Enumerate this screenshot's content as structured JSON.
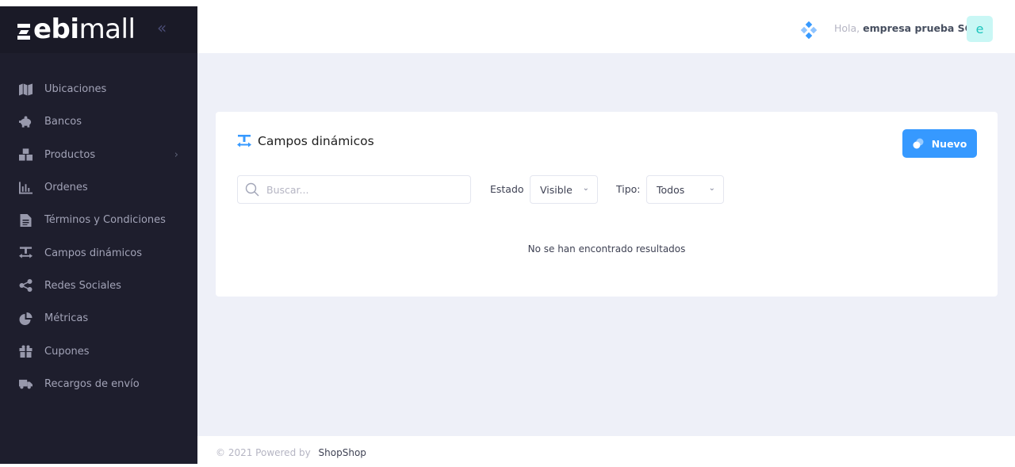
{
  "brand": {
    "logo_bold": "ebi",
    "logo_light": "mall",
    "collapse_icon": "chevrons-left-icon"
  },
  "sidebar": {
    "items": [
      {
        "label": "Ubicaciones",
        "icon": "map-icon"
      },
      {
        "label": "Bancos",
        "icon": "piggy-bank-icon"
      },
      {
        "label": "Productos",
        "icon": "boxes-icon",
        "has_submenu": true
      },
      {
        "label": "Ordenes",
        "icon": "bar-chart-icon"
      },
      {
        "label": "Términos y Condiciones",
        "icon": "document-icon"
      },
      {
        "label": "Campos dinámicos",
        "icon": "text-height-icon"
      },
      {
        "label": "Redes Sociales",
        "icon": "share-icon"
      },
      {
        "label": "Métricas",
        "icon": "pie-chart-icon"
      },
      {
        "label": "Cupones",
        "icon": "gift-icon"
      },
      {
        "label": "Recargos de envío",
        "icon": "truck-icon"
      }
    ],
    "submenu_arrow": "›"
  },
  "header": {
    "greeting_prefix": "Hola,",
    "user_name": "empresa prueba SC",
    "avatar_letter": "e",
    "apps_icon": "diamond-dots-icon"
  },
  "card": {
    "title": "Campos dinámicos",
    "new_button": "Nuevo",
    "search_placeholder": "Buscar...",
    "estado_label": "Estado",
    "estado_value": "Visible",
    "tipo_label": "Tipo:",
    "tipo_value": "Todos",
    "empty_message": "No se han encontrado resultados"
  },
  "footer": {
    "copyright": "© 2021 Powered by",
    "link": "ShopShop"
  },
  "colors": {
    "sidebar_bg": "#1e1e2d",
    "brand_bg": "#1a1a27",
    "primary": "#3699ff",
    "content_bg": "#eef0f8",
    "avatar_bg": "#c9f7f5",
    "avatar_fg": "#1bc5bd"
  }
}
